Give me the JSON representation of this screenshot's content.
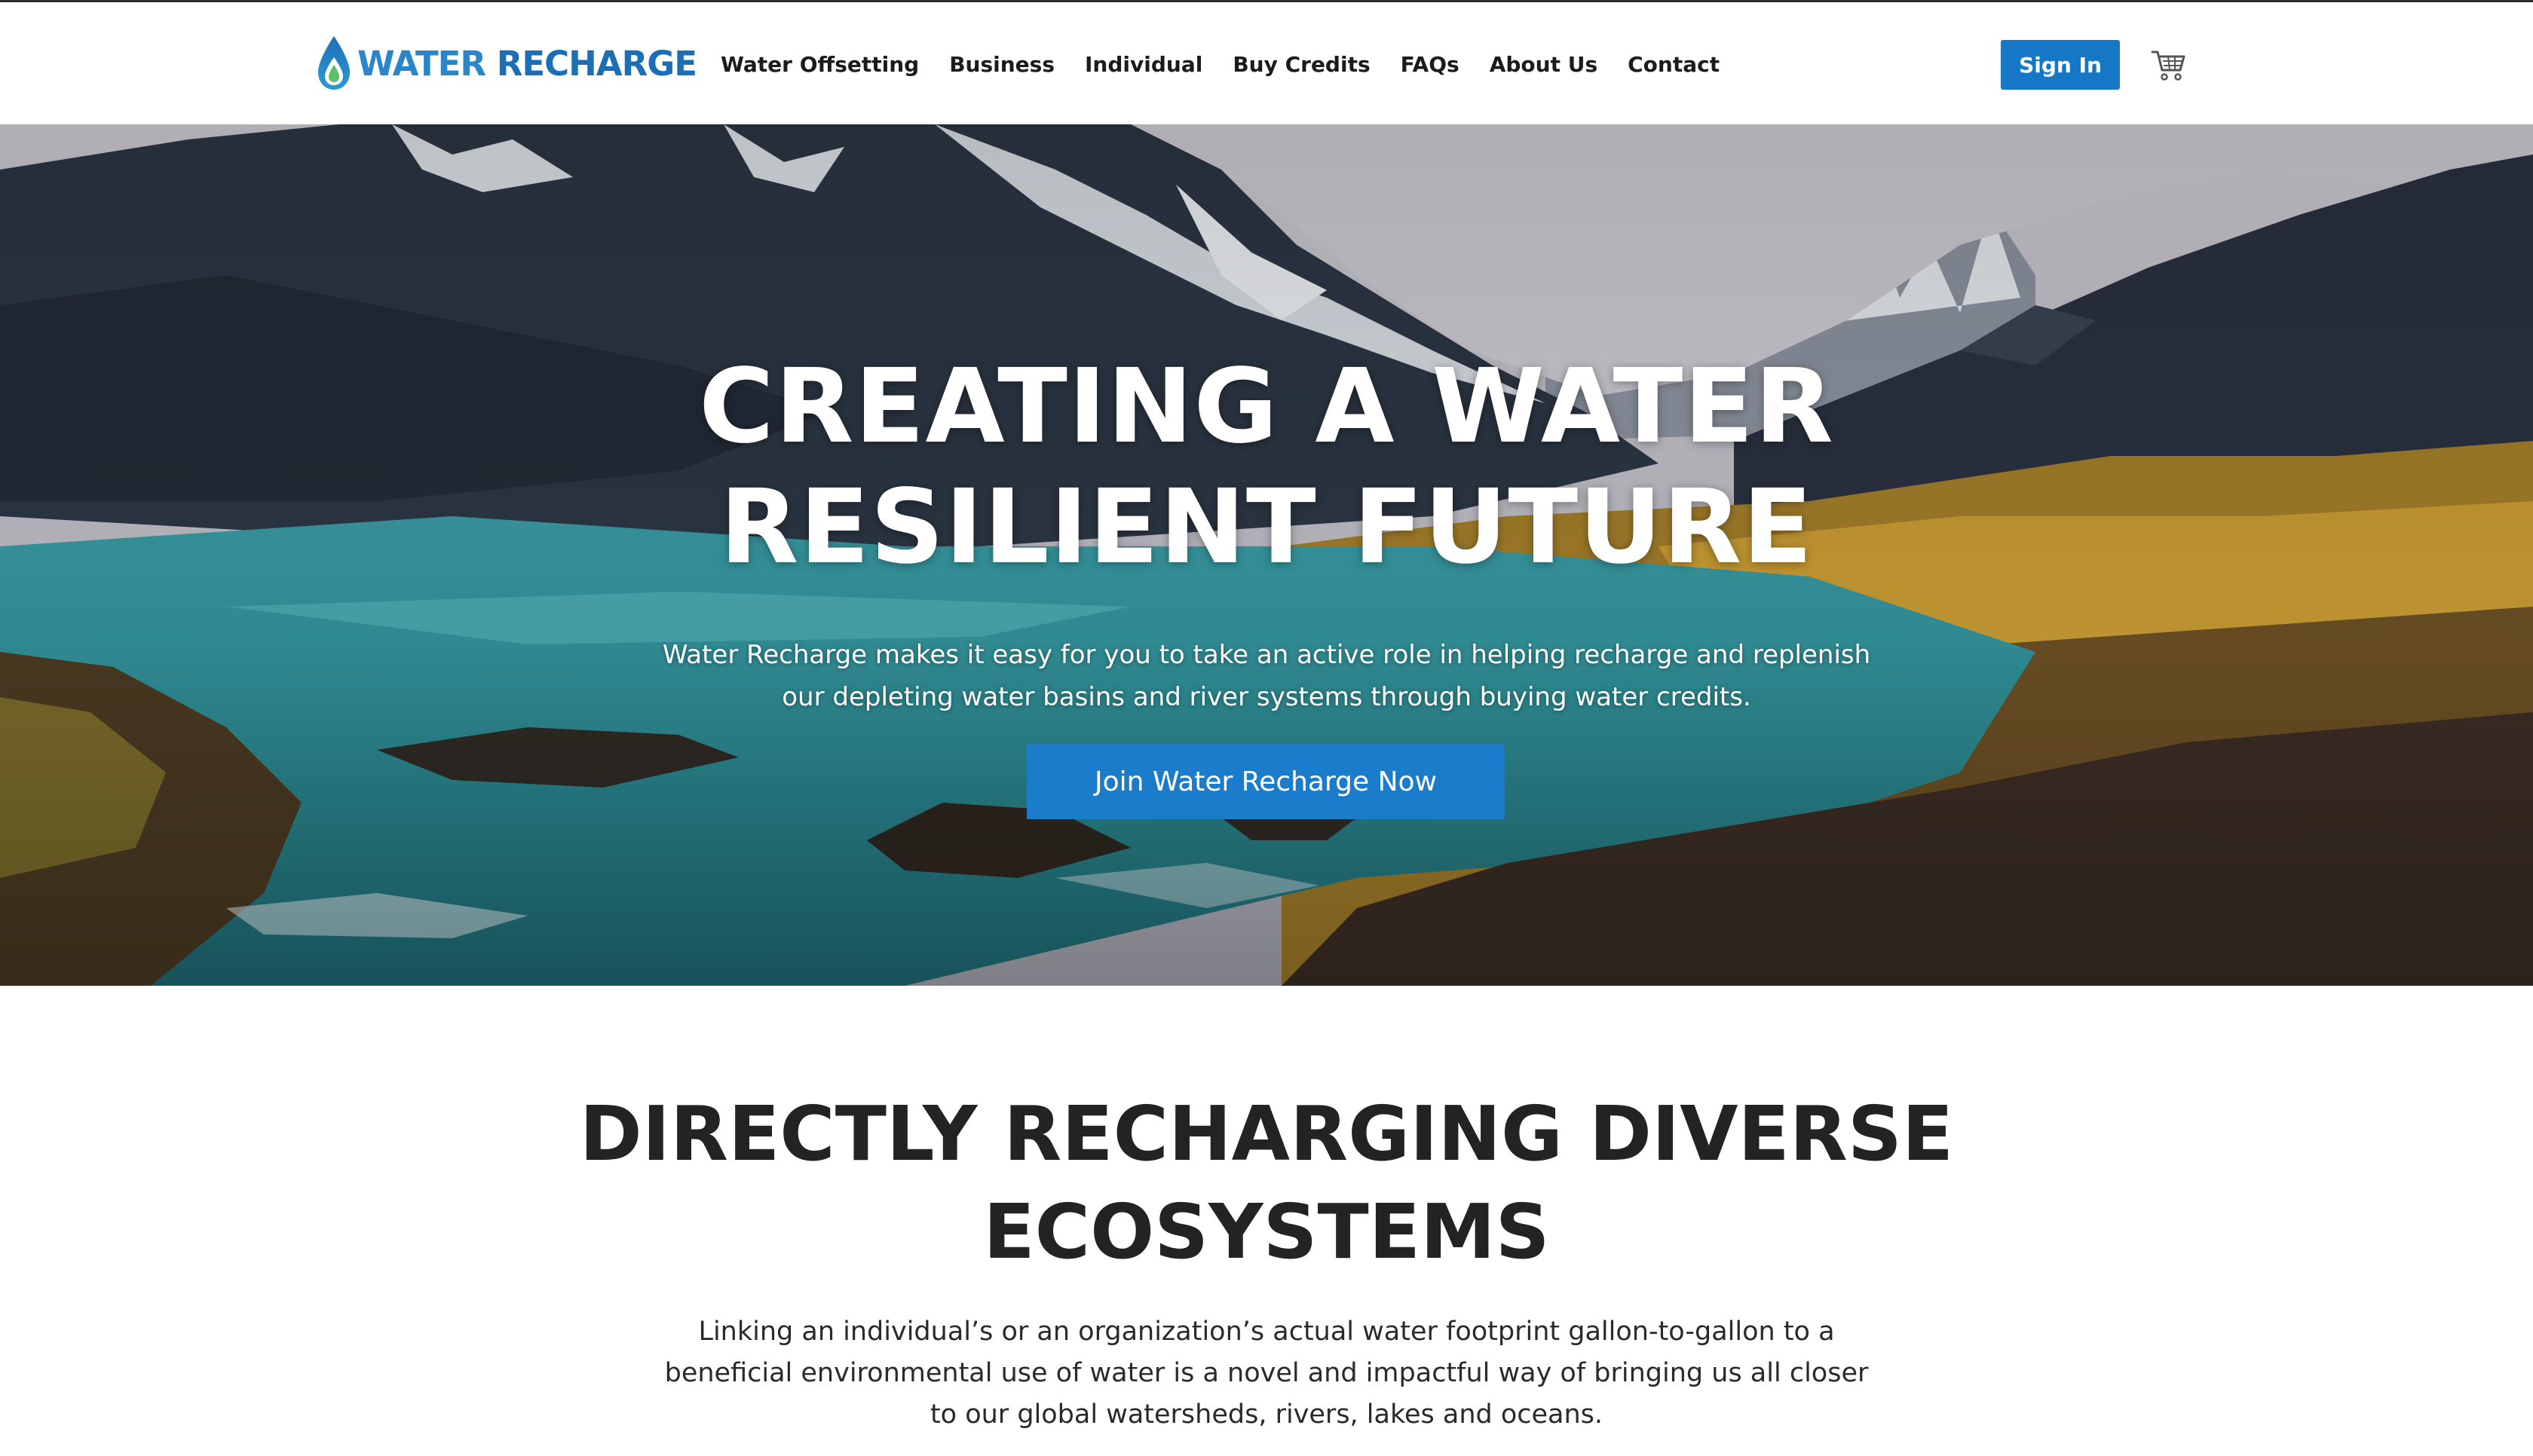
{
  "brand": {
    "word1": "WATER",
    "word2": "RECHARGE",
    "primary_color": "#1677c7",
    "logo_icon": "water-drop-icon"
  },
  "nav": {
    "items": [
      {
        "label": "Water Offsetting"
      },
      {
        "label": "Business"
      },
      {
        "label": "Individual"
      },
      {
        "label": "Buy Credits"
      },
      {
        "label": "FAQs"
      },
      {
        "label": "About Us"
      },
      {
        "label": "Contact"
      }
    ],
    "sign_in": "Sign In",
    "cart_icon": "shopping-cart-icon"
  },
  "hero": {
    "title_line1": "CREATING A WATER",
    "title_line2": "RESILIENT FUTURE",
    "subtitle": "Water Recharge makes it easy for you to take an active role in helping recharge and replenish our depleting water basins and river systems through buying water credits.",
    "cta": "Join Water Recharge Now"
  },
  "section": {
    "title_line1": "DIRECTLY RECHARGING DIVERSE",
    "title_line2": "ECOSYSTEMS",
    "text": "Linking an individual’s or an organization’s actual water footprint gallon-to-gallon to a beneficial environmental use of water is a novel and impactful way of bringing us all closer to our global watersheds, rivers, lakes and oceans."
  }
}
